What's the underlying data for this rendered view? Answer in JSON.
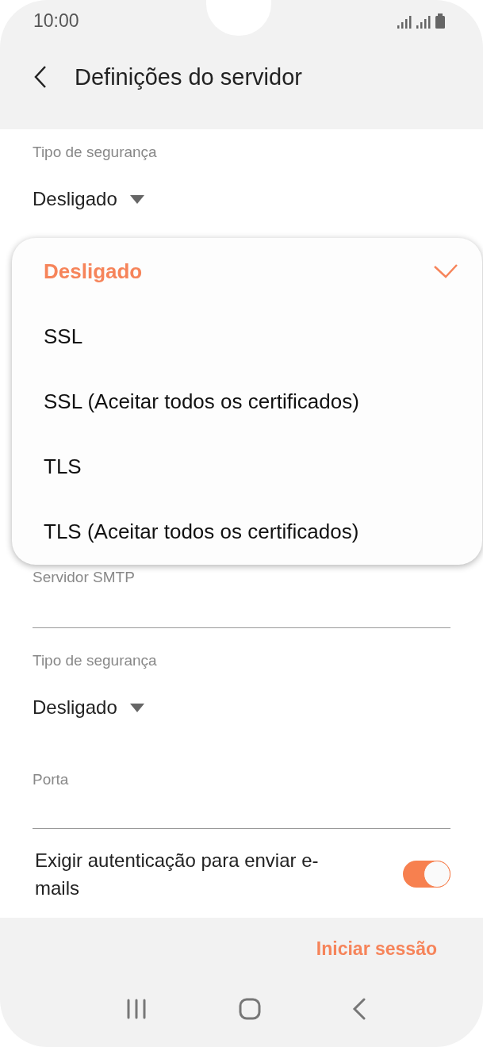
{
  "status_bar": {
    "time": "10:00"
  },
  "header": {
    "title": "Definições do servidor"
  },
  "incoming": {
    "security_label": "Tipo de segurança",
    "security_value": "Desligado"
  },
  "dropdown": {
    "options": [
      {
        "label": "Desligado",
        "selected": true
      },
      {
        "label": "SSL",
        "selected": false
      },
      {
        "label": "SSL (Aceitar todos os certificados)",
        "selected": false
      },
      {
        "label": "TLS",
        "selected": false
      },
      {
        "label": "TLS (Aceitar todos os certificados)",
        "selected": false
      }
    ]
  },
  "outgoing": {
    "server_label": "Servidor SMTP",
    "security_label": "Tipo de segurança",
    "security_value": "Desligado",
    "port_label": "Porta",
    "auth_label": "Exigir autenticação para enviar e-mails",
    "auth_on": true
  },
  "footer": {
    "button": "Iniciar sessão"
  }
}
